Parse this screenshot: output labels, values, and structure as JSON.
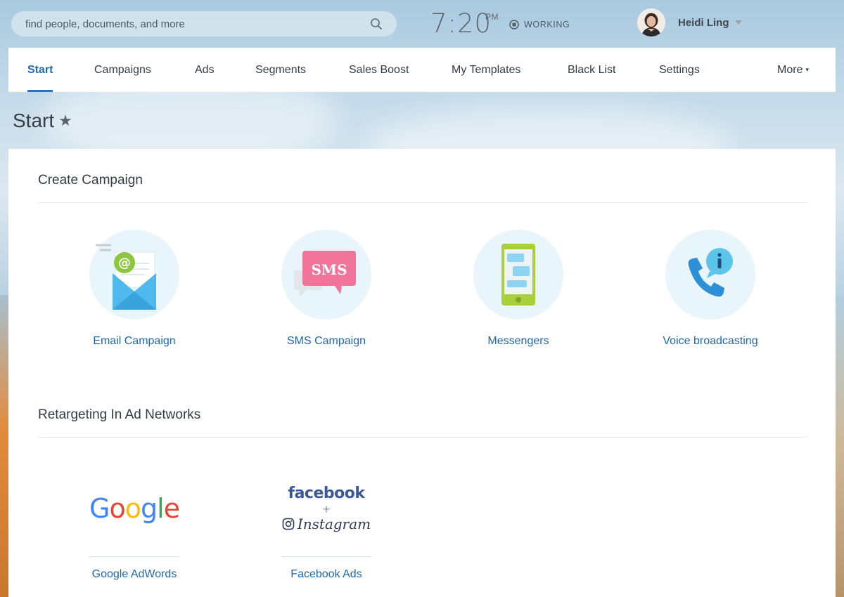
{
  "search": {
    "placeholder": "find people, documents, and more"
  },
  "clock": {
    "time": "7:20",
    "ampm": "PM",
    "status": "WORKING"
  },
  "user": {
    "name": "Heidi Ling"
  },
  "nav": {
    "items": [
      {
        "label": "Start",
        "active": true
      },
      {
        "label": "Campaigns"
      },
      {
        "label": "Ads"
      },
      {
        "label": "Segments"
      },
      {
        "label": "Sales Boost"
      },
      {
        "label": "My Templates"
      },
      {
        "label": "Black List"
      },
      {
        "label": "Settings"
      }
    ],
    "more_label": "More"
  },
  "page": {
    "title": "Start"
  },
  "create_campaign": {
    "title": "Create Campaign",
    "tiles": [
      {
        "label": "Email Campaign",
        "icon": "email-envelope-icon"
      },
      {
        "label": "SMS Campaign",
        "icon": "sms-bubble-icon",
        "badge": "SMS"
      },
      {
        "label": "Messengers",
        "icon": "messenger-phone-icon"
      },
      {
        "label": "Voice broadcasting",
        "icon": "voice-phone-icon"
      }
    ]
  },
  "retargeting": {
    "title": "Retargeting In Ad Networks",
    "networks": [
      {
        "label": "Google AdWords",
        "logo_text": "Google"
      },
      {
        "label": "Facebook Ads",
        "logo_text": "facebook",
        "plus": "+",
        "logo_text_2": "Instagram"
      }
    ]
  },
  "colors": {
    "accent": "#2067b0",
    "sms_pink": "#f3749a",
    "email_blue": "#4fb8ec",
    "phone_green": "#a9cf3b",
    "voice_blue": "#2d8fd5"
  }
}
